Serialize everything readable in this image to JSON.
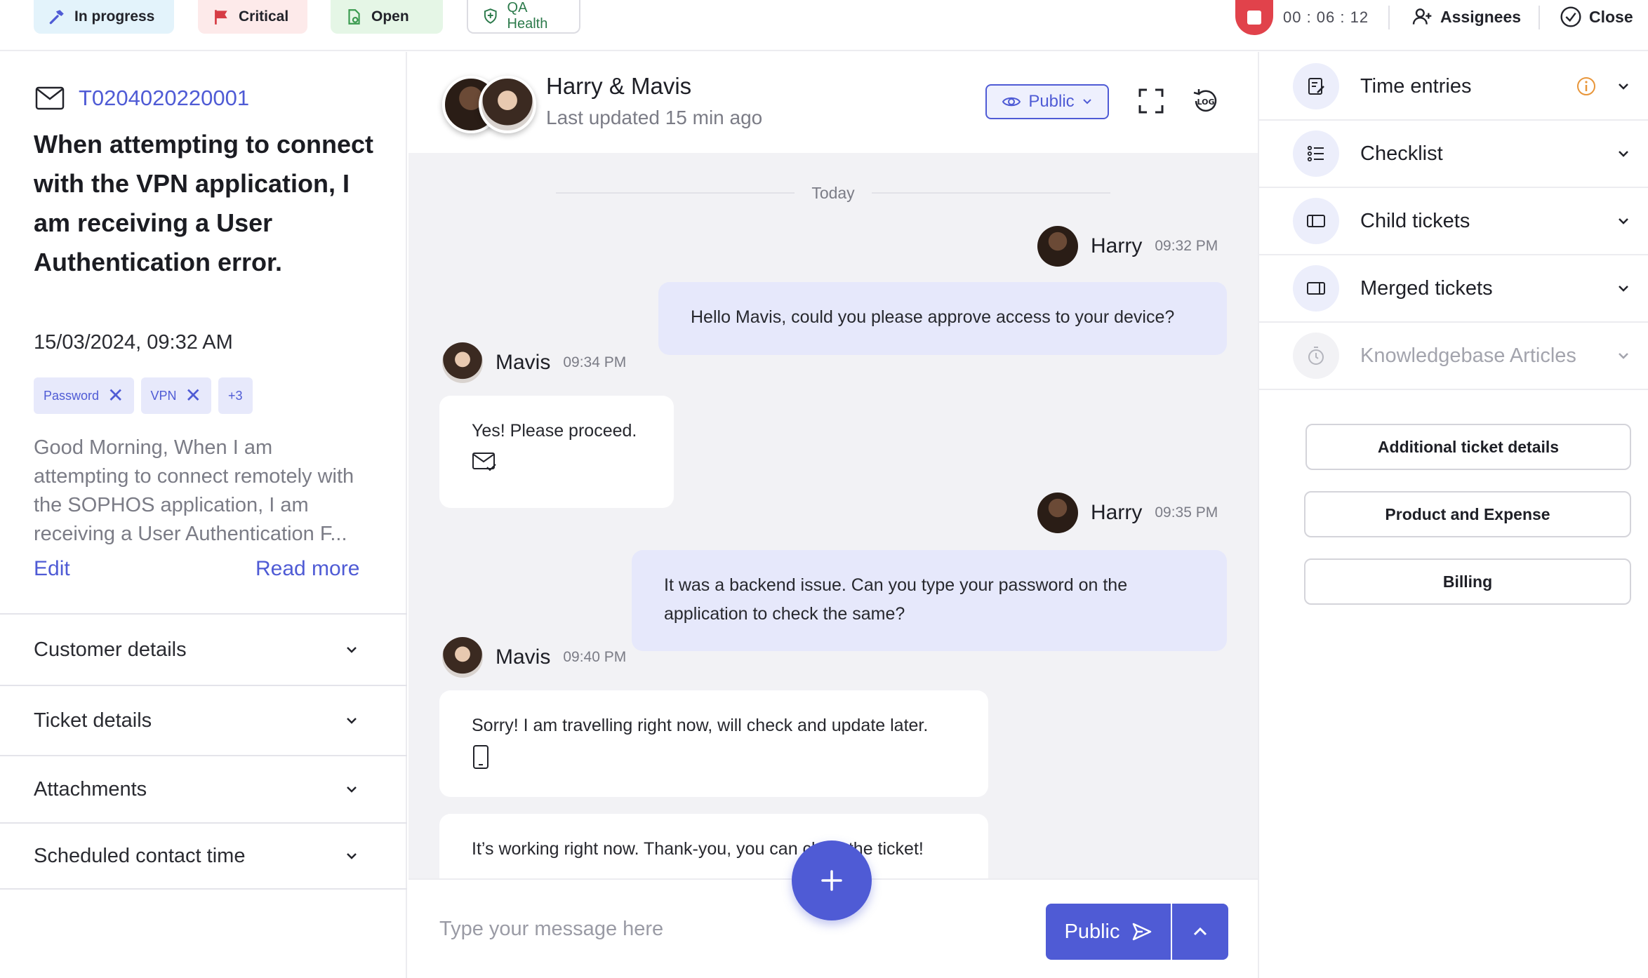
{
  "topbar": {
    "status": "In progress",
    "priority": "Critical",
    "state": "Open",
    "qa": "QA Health",
    "timer": "00 : 06 : 12",
    "assignees": "Assignees",
    "close": "Close"
  },
  "ticket": {
    "id": "T0204020220001",
    "title": "When attempting to connect with the VPN application, I am receiving a User Authentication error.",
    "date": "15/03/2024, 09:32 AM",
    "tags": [
      "Password",
      "VPN"
    ],
    "more_tags": "+3",
    "description": "Good Morning,  When I am attempting to connect remotely with the SOPHOS application, I am receiving a User Authentication F...",
    "edit": "Edit",
    "read_more": "Read more"
  },
  "left_sections": [
    "Customer details",
    "Ticket details",
    "Attachments",
    "Scheduled contact time"
  ],
  "chat": {
    "title": "Harry & Mavis",
    "subtitle": "Last updated 15 min ago",
    "visibility": "Public",
    "day_divider": "Today",
    "messages": [
      {
        "sender": "Harry",
        "time": "09:32 PM",
        "text": "Hello Mavis, could you please approve access to your device?"
      },
      {
        "sender": "Mavis",
        "time": "09:34 PM",
        "text": "Yes! Please proceed."
      },
      {
        "sender": "Harry",
        "time": "09:35 PM",
        "text": "It was a backend issue. Can you type your password on the application to check the same?"
      },
      {
        "sender": "Mavis",
        "time": "09:40 PM",
        "text": "Sorry! I am travelling right now, will check and update later."
      },
      {
        "sender": "Mavis",
        "time": "",
        "text": "It’s working right now. Thank-you, you can close the ticket!"
      }
    ],
    "composer_placeholder": "Type your message here",
    "send_label": "Public"
  },
  "right_sections": [
    {
      "label": "Time entries",
      "icon": "time-entries-icon",
      "enabled": true
    },
    {
      "label": "Checklist",
      "icon": "checklist-icon",
      "enabled": true
    },
    {
      "label": "Child tickets",
      "icon": "child-tickets-icon",
      "enabled": true
    },
    {
      "label": "Merged tickets",
      "icon": "merged-tickets-icon",
      "enabled": true
    },
    {
      "label": "Knowledgebase Articles",
      "icon": "knowledgebase-icon",
      "enabled": false
    }
  ],
  "right_buttons": [
    "Additional ticket details",
    "Product and Expense",
    "Billing"
  ],
  "colors": {
    "accent": "#4f5bd5",
    "record": "#e1424b",
    "warning": "#e8963a"
  }
}
